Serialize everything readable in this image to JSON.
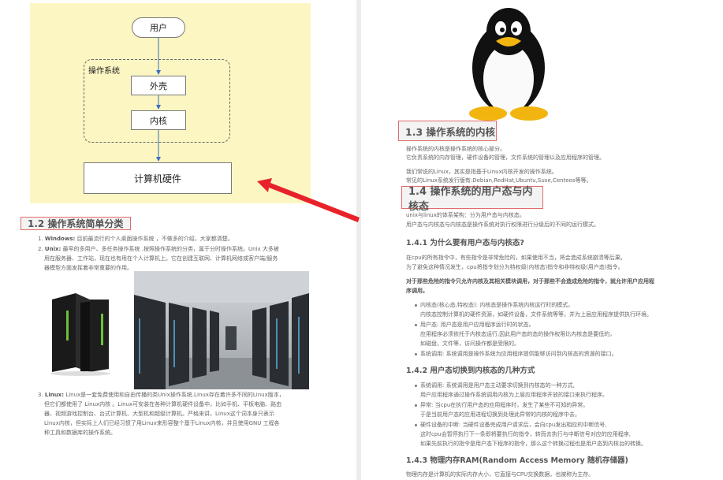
{
  "diagram": {
    "user": "用户",
    "os_label": "操作系统",
    "shell": "外壳",
    "kernel": "内核",
    "hardware": "计算机硬件"
  },
  "left": {
    "heading": "1.2 操作系统简单分类",
    "items": [
      {
        "num": "1.",
        "term": "Windows:",
        "lines": [
          "目前最流行的个人桌面操作系统 ，不做多的介绍，大家都清楚。"
        ]
      },
      {
        "num": "2.",
        "term": "Unix:",
        "lines": [
          "最早的多用户、多任务操作系统 .按照操作系统的分类，属于分时操作系统。Unix 大多被",
          "用在服务器、工作站，现在也有用在个人计算机上。它在创建互联网、计算机网络或客户端/服务",
          "器模型方面发挥着非常重要的作用。"
        ]
      },
      {
        "num": "3.",
        "term": "Linux:",
        "lines": [
          "Linux是一套免费使用和自由传播的类Unix操作系统.Linux存在着许多不同的Linux版本，",
          "但它们都使用了 Linux内核 。Linux可安装在各种计算机硬件设备中，比如手机、平板电脑、路由",
          "器、视频游戏控制台、台式计算机、大型机和超级计算机。严格来讲，Linux这个词本身只表示",
          "Linux内核，但实际上人们已经习惯了用Linux来形容整个基于Linux内核，并且使用GNU 工程各",
          "种工具和数据库的操作系统。"
        ]
      }
    ]
  },
  "right": {
    "kernel_heading": "1.3 操作系统的内核",
    "kernel_lines": [
      "操作系统的内核是操作系统的核心部分。",
      "它负责系统的内存管理，硬件设备的管理，文件系统的管理以及应用程序的管理。"
    ],
    "kernel_lines2": [
      "我们常说的Linux，其实是指基于Linux内核开发的操作系统。",
      "常见的Linux系统发行版有:Debian,RedHat,Ubuntu,Suse,Centeos等等。"
    ],
    "uk_heading": "1.4 操作系统的用户态与内核态",
    "uk_lines": [
      "unix与linux的体系架构：分为用户态与内核态。",
      "用户态与内核态与内核态是操作系统对执行权限进行分级后的不同的运行模式。"
    ],
    "q1_heading": "1.4.1 为什么要有用户态与内核态?",
    "q1_lines": [
      "在cpu的所有指令中，有些指令是非常危险的，如果使用不当，将会造成系统崩溃等后果。",
      "为了避免这种情况发生，cpu将指令划分为特权级(内核态)指令和非特权级(用户态)指令。"
    ],
    "q1_bold": [
      "对于那些危险的指令只允许内核及其相关模块调用，对于那些不会造成危险的指令，就允许用户应用程",
      "序调用。"
    ],
    "q1_bullets": [
      [
        "内核态(核心态,特权态): 内核态是操作系统内核运行时的模式。",
        "内核态控制计算机的硬件资源，如硬件设备，文件系统等等，并为上层应用程序提供执行环境。"
      ],
      [
        "用户态: 用户态是用户应用程序运行时的状态。",
        "应用程序必须依托于内核态运行,因此用户态的态的操作权限比内核态是要低的，",
        "如磁盘，文件等，访问操作都是受限的。"
      ],
      [
        "系统调用: 系统调用是操作系统为应用程序提供能够访问到内核态的资源的接口。"
      ]
    ],
    "q2_heading": "1.4.2 用户态切换到内核态的几种方式",
    "q2_bullets": [
      [
        "系统调用: 系统调用是用户态主动要求切换到内核态的一种方式,",
        "用户应用程序通过操作系统调用内核为上层应用程序开放的接口来执行程序。"
      ],
      [
        "异常: 当cpu在执行用户态的应用程序时，发生了某些不可知的异常。",
        "于是当前用户态的应用进程切换到处理此异常的内核的程序中去。"
      ],
      [
        "硬件设备的中断: 当硬件设备完成用户请求后，会向cpu发出相应的中断信号,",
        "这时cpu会暂停执行下一条即将要执行的指令，转而去执行与中断信号对应的应用程序,",
        "如果先前执行的指令是用户态下程序的指令，那么这个转换过程也是用户态到内核台的转换。"
      ]
    ],
    "q3_heading": "1.4.3 物理内存RAM(Random Access Memory 随机存储器)",
    "q3_line": "物理内存是计算机的实际内存大小，它直接与CPU交换数据，也被称为主存。"
  }
}
